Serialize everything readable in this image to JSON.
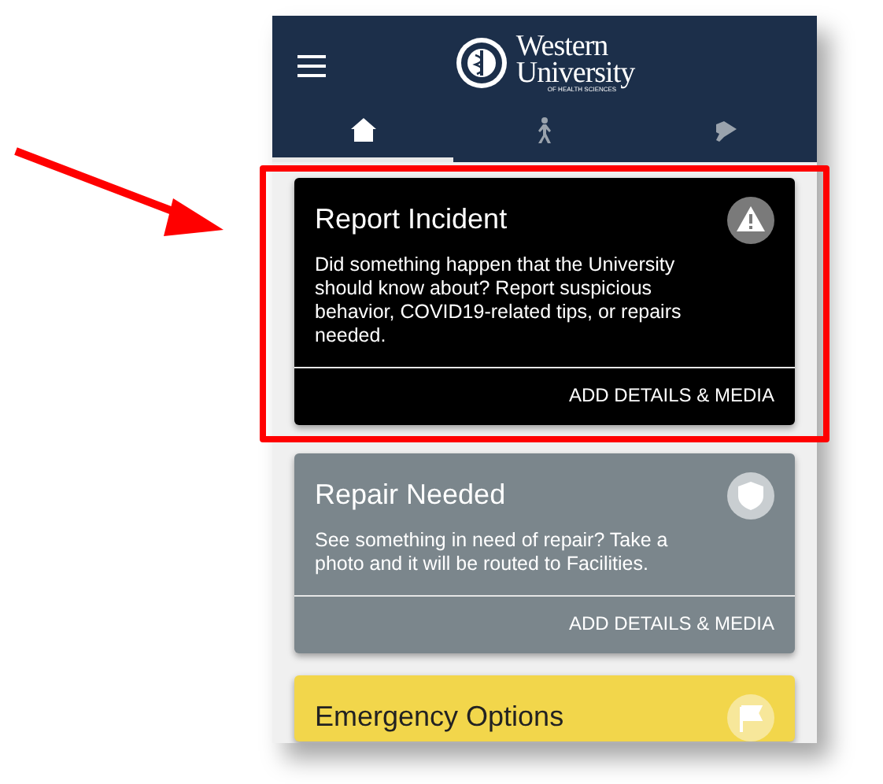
{
  "header": {
    "logo": {
      "line_1": "Western",
      "line_2": "University",
      "line_3": "OF HEALTH SCIENCES"
    }
  },
  "tabs": [
    {
      "kind": "home",
      "selected": true
    },
    {
      "kind": "walk",
      "selected": false
    },
    {
      "kind": "megaphone",
      "selected": false
    }
  ],
  "cards": [
    {
      "title": "Report Incident",
      "kind": "warning",
      "color": "#000000",
      "description": "Did something happen that the University should know about? Report suspicious behavior, COVID19-related tips, or repairs needed.",
      "action": "ADD DETAILS & MEDIA",
      "highlighted": true
    },
    {
      "title": "Repair Needed",
      "kind": "shield",
      "color": "#7b868c",
      "description": "See something in need of repair? Take a photo and it will be routed to Facilities.",
      "action": "ADD DETAILS & MEDIA",
      "highlighted": false
    },
    {
      "title": "Emergency Options",
      "kind": "flag",
      "color": "#f2d64b",
      "highlighted": false
    }
  ]
}
